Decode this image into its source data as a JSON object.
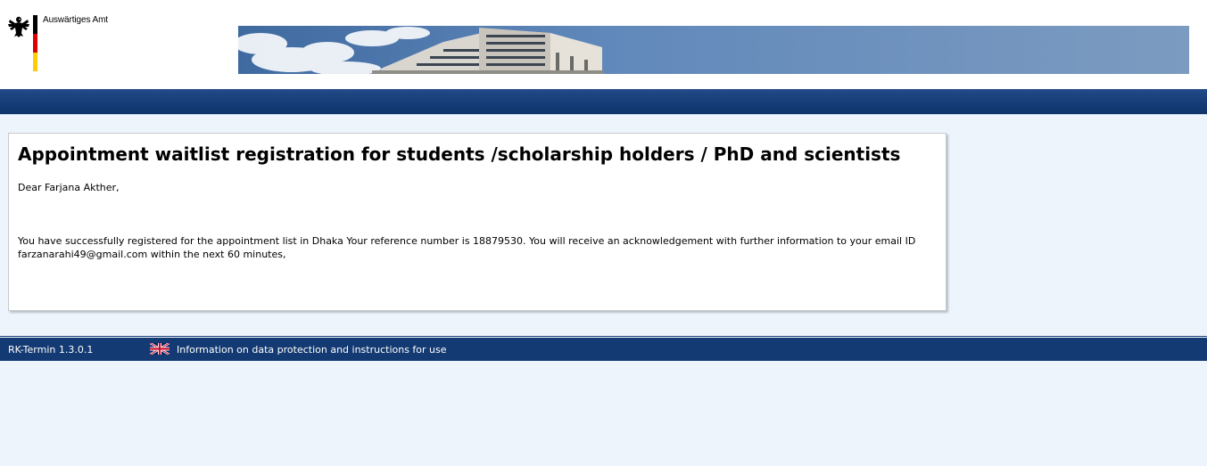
{
  "header": {
    "logo_text": "Auswärtiges Amt"
  },
  "colors": {
    "navbar": "#153c77",
    "footer": "#133a72",
    "page_background": "#eef4fb",
    "flag_black": "#000000",
    "flag_red": "#dd0000",
    "flag_gold": "#ffce00"
  },
  "main": {
    "title": "Appointment waitlist registration for students /scholarship holders / PhD and scientists",
    "salutation": "Dear Farjana Akther,",
    "message": "You have successfully registered for the appointment list in Dhaka Your reference number is 18879530. You will receive an acknowledgement with further information to your email ID farzanarahi49@gmail.com within the next 60 minutes,"
  },
  "footer": {
    "version": "RK-Termin 1.3.0.1",
    "language_icon": "uk-flag-icon",
    "info_link": "Information on data protection and instructions for use"
  }
}
